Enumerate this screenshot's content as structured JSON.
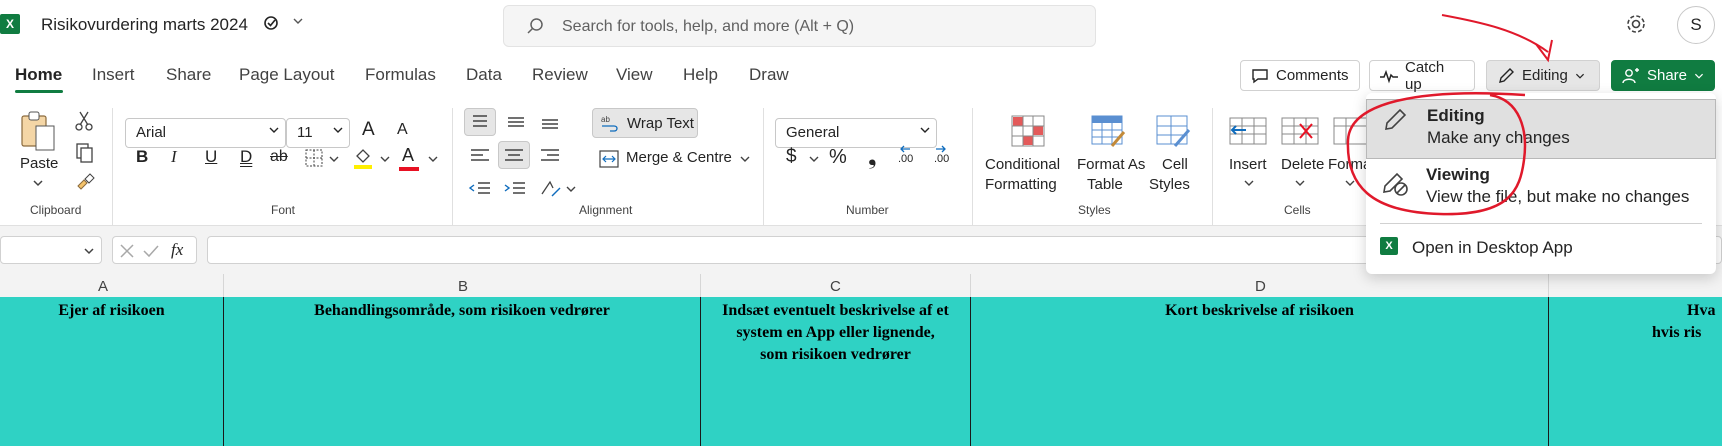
{
  "titlebar": {
    "app_icon_label": "X",
    "doc_title": "Risikovurdering marts 2024",
    "search_placeholder": "Search for tools, help, and more (Alt + Q)",
    "avatar_initial": "S"
  },
  "tabs": [
    {
      "label": "Home",
      "active": true
    },
    {
      "label": "Insert"
    },
    {
      "label": "Share"
    },
    {
      "label": "Page Layout"
    },
    {
      "label": "Formulas"
    },
    {
      "label": "Data"
    },
    {
      "label": "Review"
    },
    {
      "label": "View"
    },
    {
      "label": "Help"
    },
    {
      "label": "Draw"
    }
  ],
  "actions": {
    "comments": "Comments",
    "catch_up": "Catch up",
    "editing": "Editing",
    "share": "Share"
  },
  "ribbon": {
    "clipboard": {
      "paste": "Paste",
      "label": "Clipboard"
    },
    "font": {
      "name": "Arial",
      "size": "11",
      "label": "Font",
      "grow": "A",
      "shrink": "A",
      "bold": "B",
      "italic": "I",
      "underline": "U",
      "double_underline": "D",
      "strike": "ab",
      "font_color_letter": "A"
    },
    "alignment": {
      "wrap_text": "Wrap Text",
      "merge_centre": "Merge & Centre",
      "label": "Alignment"
    },
    "number": {
      "format": "General",
      "currency": "$",
      "percent": "%",
      "comma": "❟",
      "inc_decimal": ".00",
      "dec_decimal": ".00",
      "label": "Number"
    },
    "styles": {
      "conditional_1": "Conditional",
      "conditional_2": "Formatting",
      "format_as_1": "Format As",
      "format_as_2": "Table",
      "cell_styles_1": "Cell",
      "cell_styles_2": "Styles",
      "label": "Styles"
    },
    "cells": {
      "insert": "Insert",
      "delete": "Delete",
      "format": "Forma",
      "label": "Cells"
    }
  },
  "formula_bar": {
    "fx": "fx"
  },
  "columns": [
    "A",
    "B",
    "C",
    "D"
  ],
  "cells": {
    "a": "Ejer af risikoen",
    "b": "Behandlingsområde, som risikoen vedrører",
    "c_1": "Indsæt eventuelt beskrivelse af et",
    "c_2": "system en App eller lignende,",
    "c_3": "som risikoen vedrører",
    "d": "Kort beskrivelse af risikoen",
    "e_1": "Hva",
    "e_2": "hvis ris"
  },
  "editing_menu": {
    "editing_title": "Editing",
    "editing_desc": "Make any changes",
    "viewing_title": "Viewing",
    "viewing_desc": "View the file, but make no changes",
    "open_desktop": "Open in Desktop App"
  },
  "colors": {
    "brand_green": "#107c41",
    "grid_header_fill": "#2fd2c4",
    "annotation_red": "#e0192b"
  }
}
